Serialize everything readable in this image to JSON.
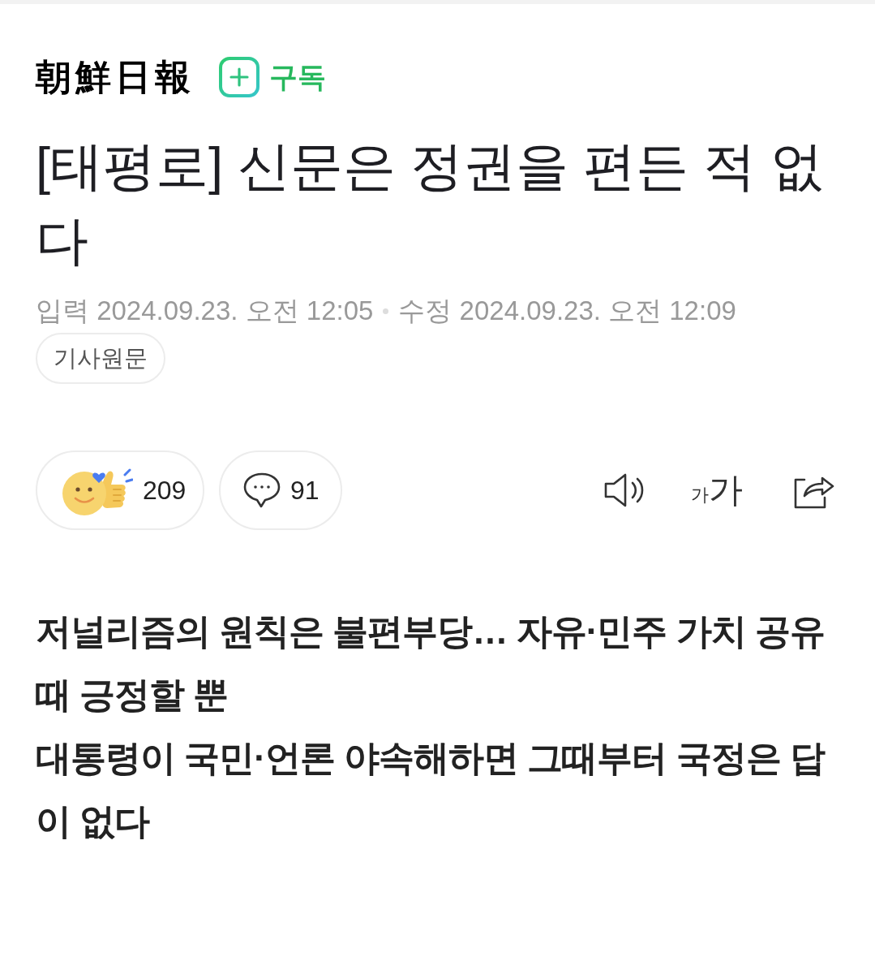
{
  "header": {
    "logo": "朝鮮日報",
    "subscribe_label": "구독"
  },
  "article": {
    "title": "[태평로] 신문은 정권을 편든 적 없다",
    "published": {
      "label": "입력",
      "value": "2024.09.23. 오전 12:05"
    },
    "modified": {
      "label": "수정",
      "value": "2024.09.23. 오전 12:09"
    },
    "original_link": "기사원문"
  },
  "reactions": {
    "like_count": "209",
    "comment_count": "91"
  },
  "tools": {
    "font_size": {
      "small": "가",
      "large": "가"
    }
  },
  "subtitle_lines": [
    "저널리즘의 원칙은 불편부당… 자유·민주 가치 공유 때 긍정할 뿐",
    "대통령이 국민·언론 야속해하면 그때부터 국정은 답이 없다"
  ]
}
